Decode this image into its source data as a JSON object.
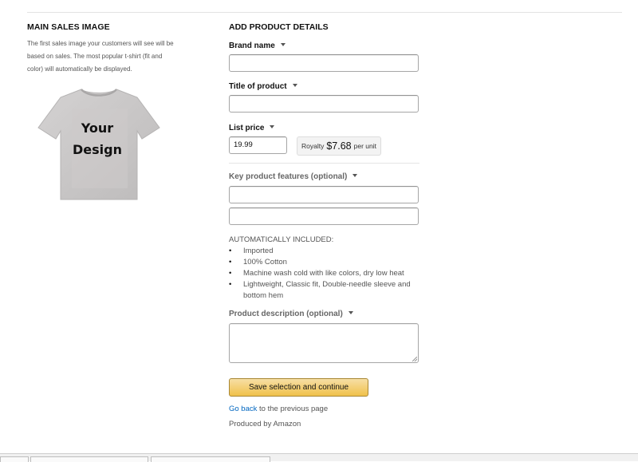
{
  "left": {
    "title": "MAIN SALES IMAGE",
    "description": "The first sales image your customers will see will be based on sales. The most popular t-shirt (fit and color) will automatically be displayed.",
    "shirt_text_line1": "Your",
    "shirt_text_line2": "Design",
    "shirt_color": "#c9c7c7"
  },
  "right": {
    "title": "ADD PRODUCT DETAILS",
    "brand_label": "Brand name",
    "brand_value": "",
    "title_label": "Title of product",
    "title_value": "",
    "price_label": "List price",
    "price_value": "19.99",
    "royalty_label": "Royalty",
    "royalty_amount": "$7.68",
    "royalty_unit": "per unit",
    "features_label": "Key product features (optional)",
    "feature1_value": "",
    "feature2_value": "",
    "auto_title": "AUTOMATICALLY INCLUDED:",
    "auto_items": [
      "Imported",
      "100% Cotton",
      "Machine wash cold with like colors, dry low heat",
      "Lightweight, Classic fit, Double-needle sleeve and bottom hem"
    ],
    "description_label": "Product description (optional)",
    "description_value": "",
    "save_button": "Save selection and continue",
    "go_back_link": "Go back",
    "go_back_rest": " to the previous page",
    "produced_by": "Produced by Amazon"
  },
  "colors": {
    "button_top": "#f7dfa5",
    "button_bottom": "#f0c14b",
    "link": "#0066c0"
  }
}
